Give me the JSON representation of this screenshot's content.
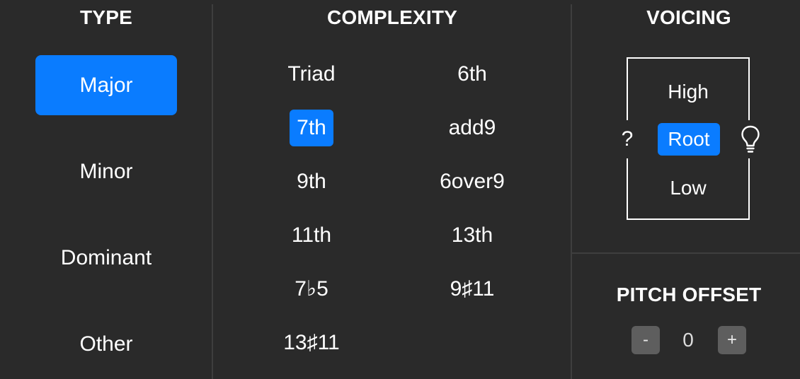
{
  "type_panel": {
    "heading": "TYPE",
    "options": [
      "Major",
      "Minor",
      "Dominant",
      "Other"
    ],
    "selected": "Major"
  },
  "complexity_panel": {
    "heading": "COMPLEXITY",
    "options": [
      "Triad",
      "6th",
      "7th",
      "add9",
      "9th",
      "6over9",
      "11th",
      "13th",
      "7♭5",
      "9♯11",
      "13♯11"
    ],
    "selected": "7th"
  },
  "voicing_panel": {
    "heading": "VOICING",
    "high_label": "High",
    "root_label": "Root",
    "low_label": "Low",
    "help_label": "?",
    "selected": "Root"
  },
  "pitch_offset": {
    "heading": "PITCH OFFSET",
    "minus_label": "-",
    "value": "0",
    "plus_label": "+"
  },
  "colors": {
    "background": "#2a2a2a",
    "accent": "#0a7cff",
    "divider": "#3e3e3e",
    "stepper": "#5e5e5e"
  },
  "icons": {
    "help": "question-mark-icon",
    "hint": "lightbulb-icon"
  }
}
